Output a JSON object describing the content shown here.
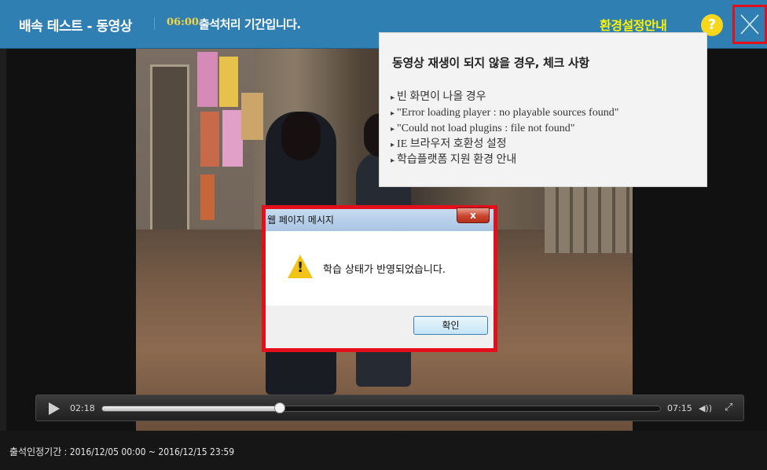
{
  "header": {
    "title": "배속 테스트 - 동영상",
    "time": "06:00",
    "notice": "출석처리 기간입니다.",
    "env_guide_label": "환경설정안내",
    "help_glyph": "?",
    "close_glyph": "✕"
  },
  "guide": {
    "title": "동영상 재생이 되지 않을 경우, 체크 사항",
    "bullet": "▸",
    "items": [
      "빈 화면이 나올 경우",
      "\"Error loading player : no playable sources found\"",
      "\"Could not load plugins : file not found\"",
      "IE 브라우저 호환성 설정",
      "학습플랫폼 지원 환경 안내"
    ]
  },
  "dialog": {
    "title": "웹 페이지 메시지",
    "close_glyph": "x",
    "message": "학습 상태가 반영되었습니다.",
    "ok_label": "확인"
  },
  "player": {
    "current_time": "02:18",
    "total_time": "07:15",
    "progress": 0.318,
    "volume_glyph": "◀))",
    "fullscreen_glyph": "⤢"
  },
  "footer": {
    "period": "출석인정기간 : 2016/12/05 00:00 ~ 2016/12/15 23:59"
  },
  "colors": {
    "header_bg": "#2f7fb3",
    "accent_yellow": "#fff200",
    "highlight_red": "#e3101b"
  }
}
